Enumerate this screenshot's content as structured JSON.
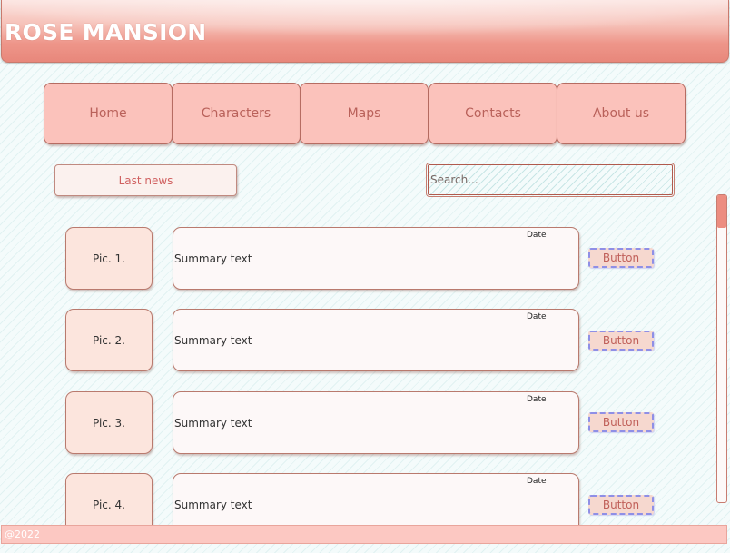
{
  "site": {
    "title": "ROSE MANSION"
  },
  "nav": {
    "items": [
      {
        "label": "Home"
      },
      {
        "label": "Characters"
      },
      {
        "label": "Maps"
      },
      {
        "label": "Contacts"
      },
      {
        "label": "About us"
      }
    ]
  },
  "last_news": {
    "label": "Last news"
  },
  "search": {
    "placeholder": "Search...",
    "value": ""
  },
  "news": {
    "items": [
      {
        "pic": "Pic. 1.",
        "summary": "Summary text",
        "date": "Date",
        "button": "Button"
      },
      {
        "pic": "Pic. 2.",
        "summary": "Summary text",
        "date": "Date",
        "button": "Button"
      },
      {
        "pic": "Pic. 3.",
        "summary": "Summary text",
        "date": "Date",
        "button": "Button"
      },
      {
        "pic": "Pic. 4.",
        "summary": "Summary text",
        "date": "Date",
        "button": "Button"
      }
    ]
  },
  "footer": {
    "text": "@2022"
  },
  "colors": {
    "accent": "#e8877b",
    "nav_bg": "#fbc2bb",
    "nav_text": "#b9615a",
    "button_border": "#8f8fe6"
  }
}
